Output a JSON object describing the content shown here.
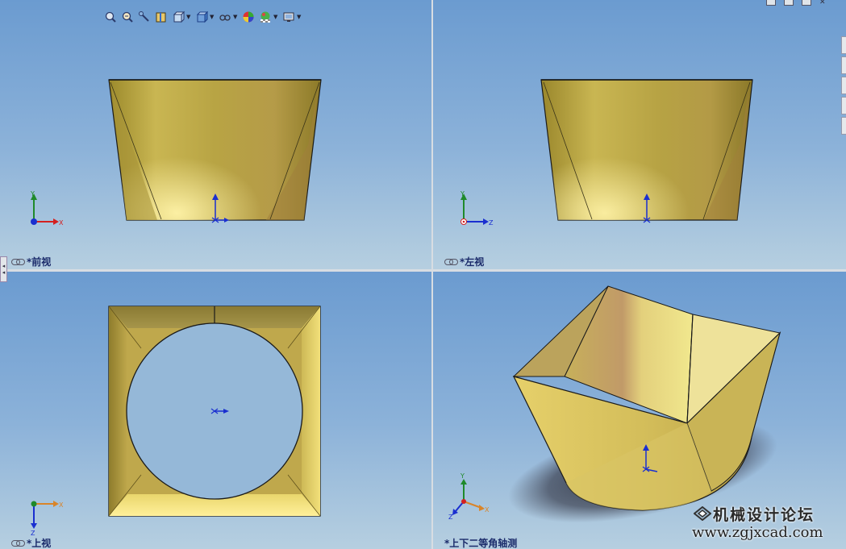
{
  "views": {
    "front": {
      "label": "*前视"
    },
    "left": {
      "label": "*左视"
    },
    "top": {
      "label": "*上视"
    },
    "iso": {
      "label": "*上下二等角轴测"
    }
  },
  "triad": {
    "x": "X",
    "y": "Y",
    "z": "Z",
    "x_color": "#d42020",
    "y_color": "#1f8a2a",
    "z_color": "#1a2fd0",
    "x_top_color": "#d9852a"
  },
  "toolbar": {
    "items": [
      {
        "icon": "zoom-to-fit-icon"
      },
      {
        "icon": "zoom-to-area-icon"
      },
      {
        "icon": "previous-view-icon"
      },
      {
        "icon": "section-view-icon"
      },
      {
        "icon": "view-orientation-icon",
        "dropdown": true
      },
      {
        "icon": "display-style-icon",
        "dropdown": true
      },
      {
        "icon": "hide-show-items-icon",
        "dropdown": true
      },
      {
        "icon": "edit-appearance-icon"
      },
      {
        "icon": "apply-scene-icon",
        "dropdown": true
      },
      {
        "icon": "view-settings-icon",
        "dropdown": true
      }
    ]
  },
  "watermark": {
    "title": "机械设计论坛",
    "url": "www.zgjxcad.com"
  },
  "colors": {
    "part_gold": "#c9b450",
    "edge": "#1a1a1a",
    "background_top": "#6b9bd0",
    "background_bottom": "#b6cfe0"
  }
}
